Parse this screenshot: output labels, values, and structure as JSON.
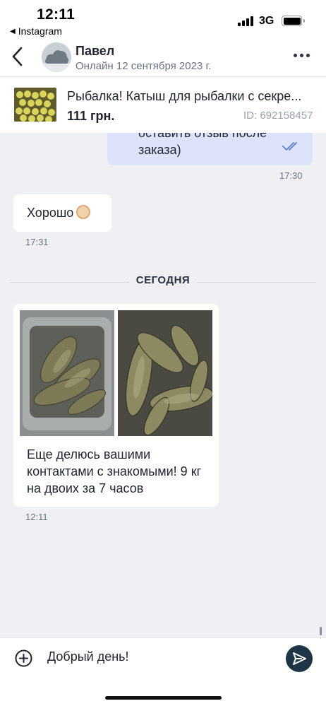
{
  "status_bar": {
    "time": "12:11",
    "back_app": "Instagram",
    "network": "3G"
  },
  "header": {
    "name": "Павел",
    "online": "Онлайн 12 сентября 2023 г."
  },
  "product": {
    "title": "Рыбалка! Катыш для рыбалки с секре...",
    "price": "111 грн.",
    "id": "ID: 692158457"
  },
  "messages": {
    "outgoing_text_line1": "оставить отзыв после",
    "outgoing_text_line2": "заказа)",
    "outgoing_time": "17:30",
    "hello_text": "Хорошо",
    "hello_time": "17:31",
    "divider": "СЕГОДНЯ",
    "photo_text": "Еще делюсь вашими контактами с знакомыми! 9 кг на двоих за 7 часов",
    "photo_time": "12:11"
  },
  "composer": {
    "input_value": "Добрый день!"
  },
  "colors": {
    "outgoing_bubble": "#dde3fb",
    "send_button": "#1f3444",
    "read_ticks": "#5a7ee0"
  }
}
